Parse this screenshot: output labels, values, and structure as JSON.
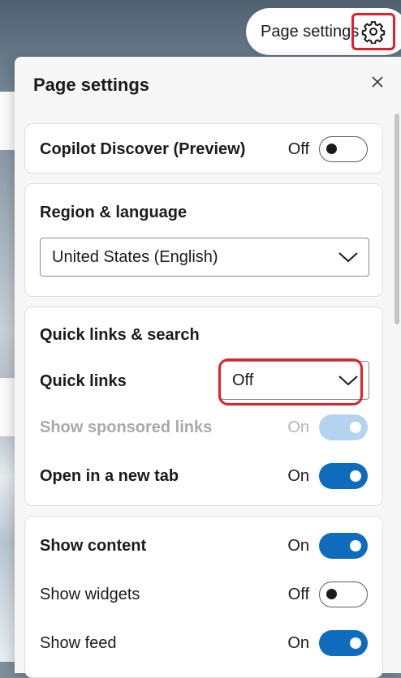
{
  "header": {
    "pill_label": "Page settings"
  },
  "panel": {
    "title": "Page settings"
  },
  "copilot": {
    "label": "Copilot Discover (Preview)",
    "state": "Off",
    "on": false
  },
  "region": {
    "title": "Region & language",
    "selected": "United States (English)"
  },
  "quicklinks": {
    "title": "Quick links & search",
    "quick_links_label": "Quick links",
    "quick_links_value": "Off",
    "sponsored_label": "Show sponsored links",
    "sponsored_state": "On",
    "newtab_label": "Open in a new tab",
    "newtab_state": "On"
  },
  "content": {
    "show_content_label": "Show content",
    "show_content_state": "On",
    "widgets_label": "Show widgets",
    "widgets_state": "Off",
    "feed_label": "Show feed",
    "feed_state": "On"
  },
  "colors": {
    "accent": "#0f6cbd",
    "highlight": "#e0202a"
  }
}
